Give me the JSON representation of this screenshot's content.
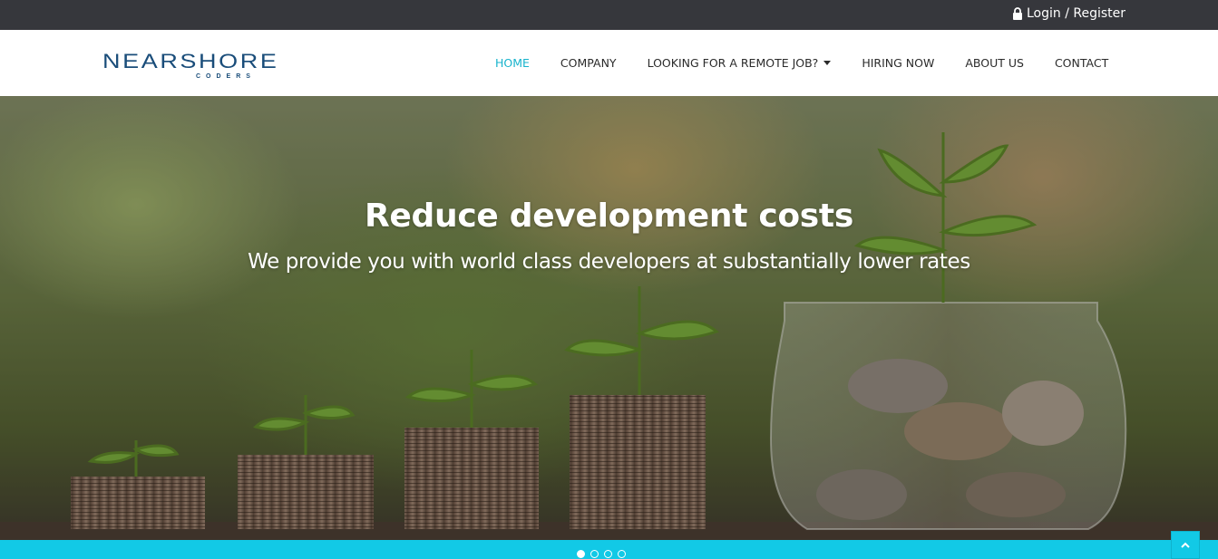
{
  "topbar": {
    "login_label": "Login / Register",
    "login_icon": "lock-icon"
  },
  "brand": {
    "name": "NEARSHORE",
    "tagline": "CODERS",
    "color": "#1a4d7a"
  },
  "nav": {
    "items": [
      {
        "label": "HOME",
        "active": true
      },
      {
        "label": "COMPANY"
      },
      {
        "label": "LOOKING FOR A REMOTE JOB?",
        "dropdown": true
      },
      {
        "label": "HIRING NOW"
      },
      {
        "label": "ABOUT US"
      },
      {
        "label": "CONTACT"
      }
    ],
    "active_color": "#17b3cc"
  },
  "hero": {
    "title": "Reduce development costs",
    "subtitle": "We provide you with world class developers at substantially lower rates"
  },
  "carousel": {
    "slide_count": 4,
    "active_index": 0
  },
  "colors": {
    "topbar_bg": "#36373c",
    "accent": "#12c9e6"
  },
  "back_to_top_icon": "chevron-up-icon"
}
